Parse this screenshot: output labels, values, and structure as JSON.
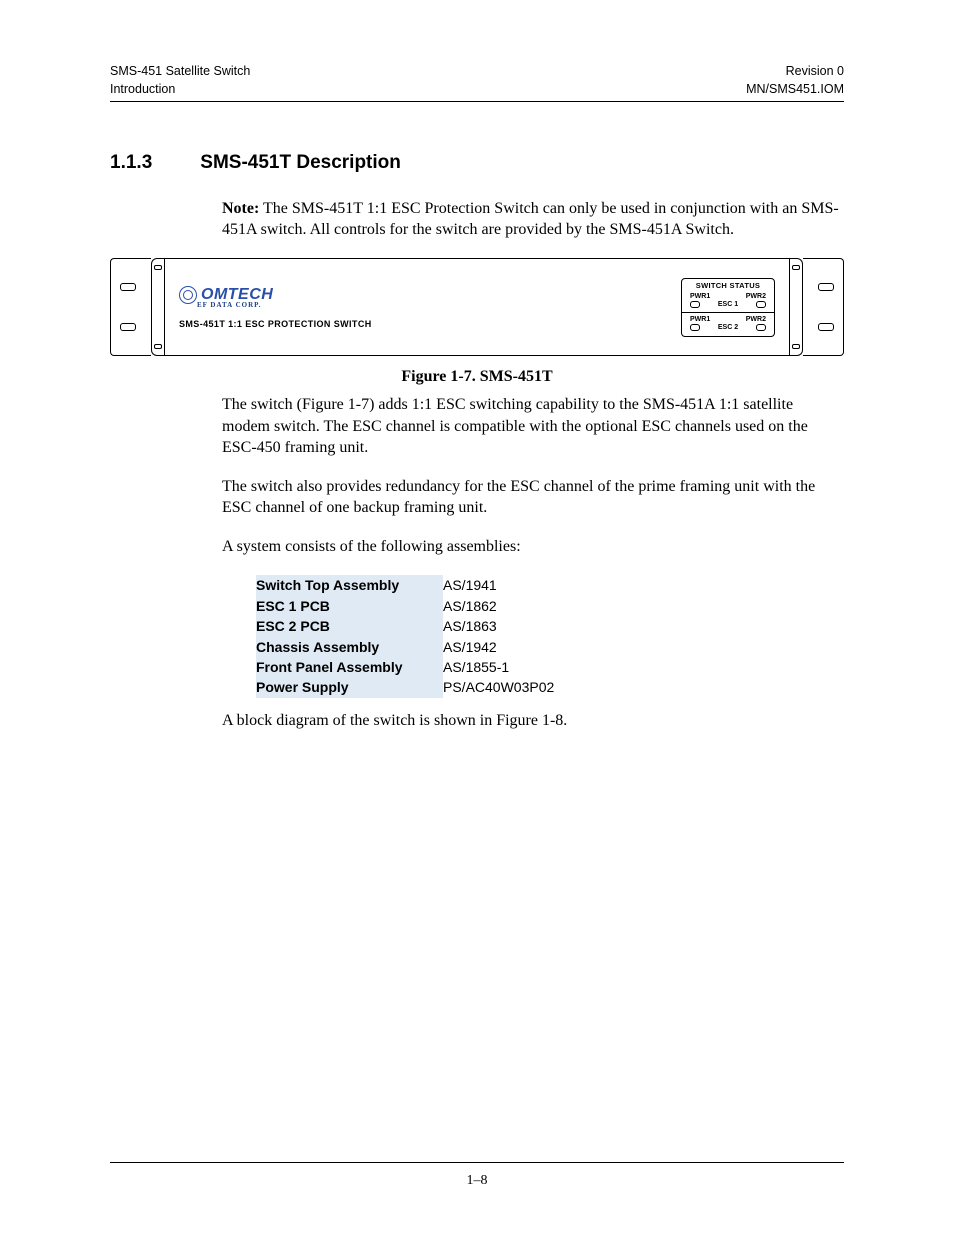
{
  "header": {
    "left1": "SMS-451 Satellite Switch",
    "left2": "Introduction",
    "right1": "Revision 0",
    "right2": "MN/SMS451.IOM"
  },
  "section": {
    "number": "1.1.3",
    "title": "SMS-451T Description"
  },
  "note": {
    "label": "Note:",
    "text": "The SMS-451T 1:1 ESC Protection Switch can only be used in conjunction with an SMS-451A switch. All controls for the switch are provided by the SMS-451A Switch."
  },
  "figure": {
    "caption": "Figure 1-7.  SMS-451T",
    "brand": "OMTECH",
    "brand_sub": "EF DATA CORP.",
    "model": "SMS-451T 1:1 ESC PROTECTION SWITCH",
    "status": {
      "title": "SWITCH STATUS",
      "pwr1": "PWR1",
      "pwr2": "PWR2",
      "esc1": "ESC 1",
      "esc2": "ESC 2"
    }
  },
  "para1": "The switch (Figure 1-7) adds 1:1 ESC switching capability to the SMS-451A 1:1 satellite modem switch. The ESC channel is compatible with the optional ESC channels used on the ESC-450 framing unit.",
  "para2": "The switch also provides redundancy for the ESC channel of the prime framing unit with the ESC channel of one backup framing unit.",
  "para3": "A system consists of the following assemblies:",
  "assemblies": [
    {
      "name": "Switch Top Assembly",
      "pn": "AS/1941"
    },
    {
      "name": "ESC 1 PCB",
      "pn": "AS/1862"
    },
    {
      "name": "ESC 2 PCB",
      "pn": "AS/1863"
    },
    {
      "name": "Chassis Assembly",
      "pn": "AS/1942"
    },
    {
      "name": "Front Panel Assembly",
      "pn": "AS/1855-1"
    },
    {
      "name": "Power Supply",
      "pn": "PS/AC40W03P02"
    }
  ],
  "para4": "A block diagram of the switch is shown in Figure 1-8.",
  "footer": {
    "page": "1–8"
  }
}
